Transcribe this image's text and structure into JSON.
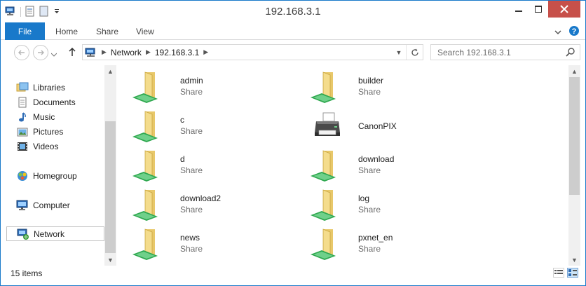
{
  "window": {
    "title": "192.168.3.1"
  },
  "ribbon": {
    "tabs": [
      {
        "label": "File"
      },
      {
        "label": "Home"
      },
      {
        "label": "Share"
      },
      {
        "label": "View"
      }
    ]
  },
  "address": {
    "crumbs": [
      "Network",
      "192.168.3.1"
    ]
  },
  "search": {
    "placeholder": "Search 192.168.3.1"
  },
  "nav": {
    "items": [
      {
        "label": "Libraries",
        "icon": "libraries-icon"
      },
      {
        "label": "Documents",
        "icon": "documents-icon"
      },
      {
        "label": "Music",
        "icon": "music-icon"
      },
      {
        "label": "Pictures",
        "icon": "pictures-icon"
      },
      {
        "label": "Videos",
        "icon": "videos-icon"
      },
      {
        "label": "Homegroup",
        "icon": "homegroup-icon"
      },
      {
        "label": "Computer",
        "icon": "computer-icon"
      },
      {
        "label": "Network",
        "icon": "network-icon"
      }
    ]
  },
  "items": [
    {
      "name": "admin",
      "type": "Share",
      "icon": "shared-folder-icon"
    },
    {
      "name": "builder",
      "type": "Share",
      "icon": "shared-folder-icon"
    },
    {
      "name": "c",
      "type": "Share",
      "icon": "shared-folder-icon"
    },
    {
      "name": "CanonPIX",
      "type": "",
      "icon": "printer-icon"
    },
    {
      "name": "d",
      "type": "Share",
      "icon": "shared-folder-icon"
    },
    {
      "name": "download",
      "type": "Share",
      "icon": "shared-folder-icon"
    },
    {
      "name": "download2",
      "type": "Share",
      "icon": "shared-folder-icon"
    },
    {
      "name": "log",
      "type": "Share",
      "icon": "shared-folder-icon"
    },
    {
      "name": "news",
      "type": "Share",
      "icon": "shared-folder-icon"
    },
    {
      "name": "pxnet_en",
      "type": "Share",
      "icon": "shared-folder-icon"
    }
  ],
  "status": {
    "count": "15 items"
  },
  "colors": {
    "accent": "#1979ca",
    "close": "#c7504a"
  }
}
